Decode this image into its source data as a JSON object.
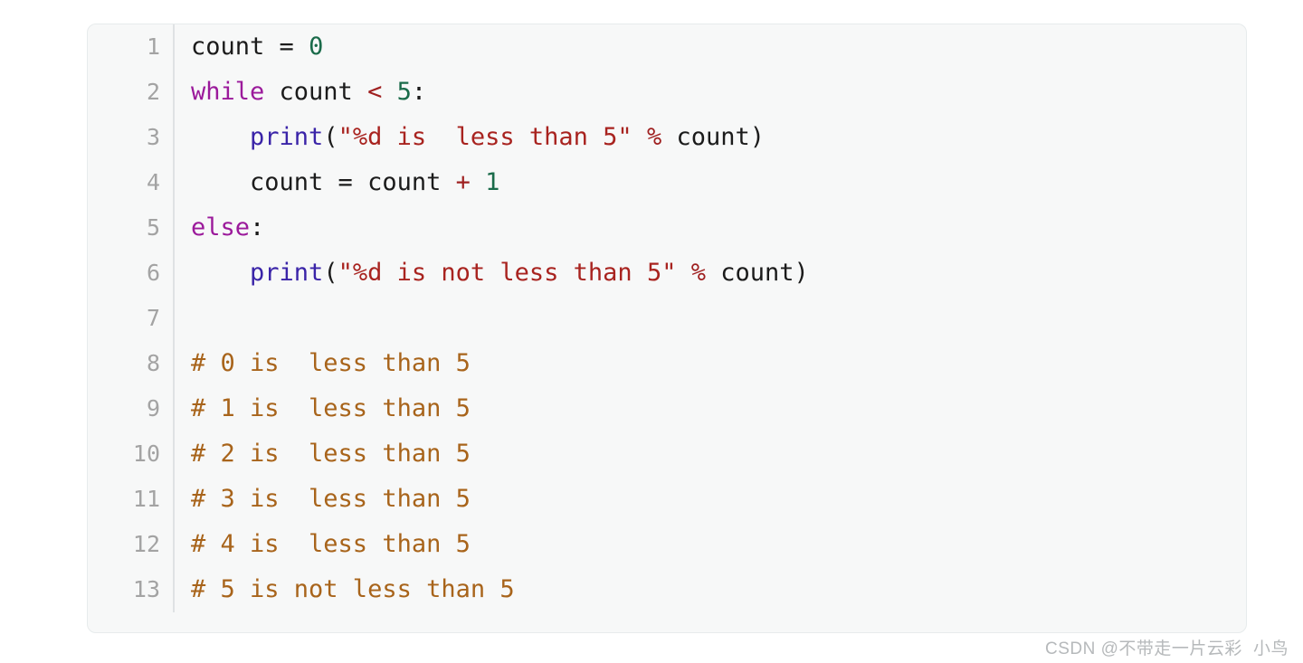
{
  "code_block": {
    "language": "python",
    "background_color": "#f7f8f8",
    "border_color": "#e7ebec",
    "gutter_divider_color": "#dfe2e4",
    "line_number_color": "#a3a3a3",
    "colors": {
      "keyword": "#9b1a9b",
      "function": "#3a24a8",
      "string": "#a8231f",
      "number": "#1a6b4a",
      "operator": "#9f2020",
      "comment": "#a8641b",
      "plain": "#1b1b1b"
    },
    "lines": [
      {
        "number": "1",
        "tokens": [
          {
            "t": "count ",
            "c": "plain"
          },
          {
            "t": "= ",
            "c": "plain"
          },
          {
            "t": "0",
            "c": "number"
          }
        ]
      },
      {
        "number": "2",
        "tokens": [
          {
            "t": "while",
            "c": "keyword"
          },
          {
            "t": " count ",
            "c": "plain"
          },
          {
            "t": "<",
            "c": "operator"
          },
          {
            "t": " ",
            "c": "plain"
          },
          {
            "t": "5",
            "c": "number"
          },
          {
            "t": ":",
            "c": "plain"
          }
        ]
      },
      {
        "number": "3",
        "tokens": [
          {
            "t": "    ",
            "c": "plain"
          },
          {
            "t": "print",
            "c": "function"
          },
          {
            "t": "(",
            "c": "plain"
          },
          {
            "t": "\"%d is  less than 5\"",
            "c": "string"
          },
          {
            "t": " ",
            "c": "plain"
          },
          {
            "t": "%",
            "c": "operator"
          },
          {
            "t": " count)",
            "c": "plain"
          }
        ]
      },
      {
        "number": "4",
        "tokens": [
          {
            "t": "    count = count ",
            "c": "plain"
          },
          {
            "t": "+",
            "c": "operator"
          },
          {
            "t": " ",
            "c": "plain"
          },
          {
            "t": "1",
            "c": "number"
          }
        ]
      },
      {
        "number": "5",
        "tokens": [
          {
            "t": "else",
            "c": "keyword"
          },
          {
            "t": ":",
            "c": "plain"
          }
        ]
      },
      {
        "number": "6",
        "tokens": [
          {
            "t": "    ",
            "c": "plain"
          },
          {
            "t": "print",
            "c": "function"
          },
          {
            "t": "(",
            "c": "plain"
          },
          {
            "t": "\"%d is not less than 5\"",
            "c": "string"
          },
          {
            "t": " ",
            "c": "plain"
          },
          {
            "t": "%",
            "c": "operator"
          },
          {
            "t": " count)",
            "c": "plain"
          }
        ]
      },
      {
        "number": "7",
        "tokens": []
      },
      {
        "number": "8",
        "tokens": [
          {
            "t": "# 0 is  less than 5",
            "c": "comment"
          }
        ]
      },
      {
        "number": "9",
        "tokens": [
          {
            "t": "# 1 is  less than 5",
            "c": "comment"
          }
        ]
      },
      {
        "number": "10",
        "tokens": [
          {
            "t": "# 2 is  less than 5",
            "c": "comment"
          }
        ]
      },
      {
        "number": "11",
        "tokens": [
          {
            "t": "# 3 is  less than 5",
            "c": "comment"
          }
        ]
      },
      {
        "number": "12",
        "tokens": [
          {
            "t": "# 4 is  less than 5",
            "c": "comment"
          }
        ]
      },
      {
        "number": "13",
        "tokens": [
          {
            "t": "# 5 is not less than 5",
            "c": "comment"
          }
        ]
      }
    ]
  },
  "watermark": {
    "text": "CSDN @不带走一片云彩 \u0001 小鸟",
    "color": "#b6b9bb"
  }
}
